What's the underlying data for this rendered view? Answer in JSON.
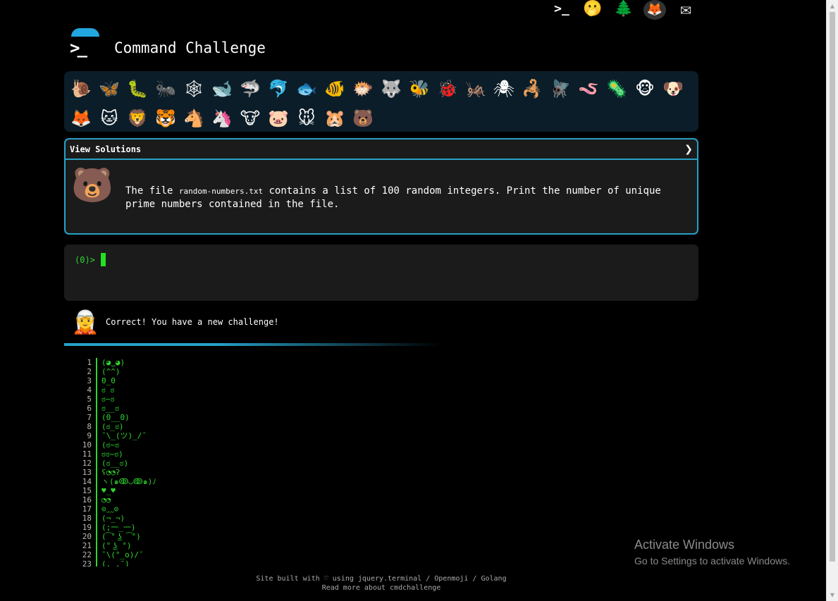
{
  "header": {
    "icons": [
      "prompt-icon",
      "hand-over-mouth-icon",
      "tree-icon",
      "gitlab-icon",
      "mail-icon"
    ]
  },
  "app": {
    "title": "Command Challenge"
  },
  "animals": [
    {
      "name": "snail-icon",
      "glyph": "🐌"
    },
    {
      "name": "butterfly-icon",
      "glyph": "🦋"
    },
    {
      "name": "caterpillar-icon",
      "glyph": "🐛"
    },
    {
      "name": "ant-icon",
      "glyph": "🐜"
    },
    {
      "name": "spiderweb-icon",
      "glyph": "🕸"
    },
    {
      "name": "whale-icon",
      "glyph": "🐋"
    },
    {
      "name": "shark-icon",
      "glyph": "🦈"
    },
    {
      "name": "dolphin-icon",
      "glyph": "🐬"
    },
    {
      "name": "fish-icon",
      "glyph": "🐟"
    },
    {
      "name": "tropical-fish-icon",
      "glyph": "🐠"
    },
    {
      "name": "blowfish-icon",
      "glyph": "🐡"
    },
    {
      "name": "wolf-icon",
      "glyph": "🐺"
    },
    {
      "name": "bee-icon",
      "glyph": "🐝"
    },
    {
      "name": "ladybug-icon",
      "glyph": "🐞"
    },
    {
      "name": "cricket-icon",
      "glyph": "🦗"
    },
    {
      "name": "spider-icon",
      "glyph": "🕷"
    },
    {
      "name": "scorpion-icon",
      "glyph": "🦂"
    },
    {
      "name": "fly-icon",
      "glyph": "🪰"
    },
    {
      "name": "worm-icon",
      "glyph": "🪱"
    },
    {
      "name": "microbe-icon",
      "glyph": "🦠"
    },
    {
      "name": "monkey-icon",
      "glyph": "🐵"
    },
    {
      "name": "dog-icon",
      "glyph": "🐶"
    },
    {
      "name": "fox-icon",
      "glyph": "🦊"
    },
    {
      "name": "cat-icon",
      "glyph": "🐱"
    },
    {
      "name": "lion-icon",
      "glyph": "🦁"
    },
    {
      "name": "tiger-icon",
      "glyph": "🐯"
    },
    {
      "name": "horse-icon",
      "glyph": "🐴"
    },
    {
      "name": "unicorn-icon",
      "glyph": "🦄"
    },
    {
      "name": "cow-icon",
      "glyph": "🐮"
    },
    {
      "name": "pig-icon",
      "glyph": "🐷"
    },
    {
      "name": "mouse-icon",
      "glyph": "🐭"
    },
    {
      "name": "hamster-icon",
      "glyph": "🐹"
    },
    {
      "name": "bear-icon",
      "glyph": "🐻"
    }
  ],
  "solutions": {
    "header_label": "View Solutions",
    "chevron": "❯",
    "avatar": "🐻",
    "challenge_prefix": "The file ",
    "challenge_file": "random-numbers.txt",
    "challenge_suffix": " contains a list of 100 random integers. Print the number of unique prime numbers contained in the file."
  },
  "terminal": {
    "prompt": "(0)>"
  },
  "feedback": {
    "avatar": "🧝",
    "message": "Correct! You have a new challenge!"
  },
  "emoticons": [
    {
      "n": "1",
      "t": "(◕‿◕)"
    },
    {
      "n": "2",
      "t": "(^^)"
    },
    {
      "n": "3",
      "t": "0_0"
    },
    {
      "n": "4",
      "t": "ಠ ಠ"
    },
    {
      "n": "5",
      "t": "ಠ~ಠ"
    },
    {
      "n": "6",
      "t": "ಠ__ಠ"
    },
    {
      "n": "7",
      "t": "(0__0)"
    },
    {
      "n": "8",
      "t": "(ಠ_ಠ)"
    },
    {
      "n": "9",
      "t": "¯\\_(ツ)_/¯"
    },
    {
      "n": "10",
      "t": "(ಠ~ಠ"
    },
    {
      "n": "11",
      "t": "ಠಠ~ಠ)"
    },
    {
      "n": "12",
      "t": "(ಠ__ಠ)"
    },
    {
      "n": "13",
      "t": "ʕ◔◔ʔ"
    },
    {
      "n": "14",
      "t": "ヽ(๑ↂ◡ↂ๑)ﾉ"
    },
    {
      "n": "15",
      "t": "♥_♥"
    },
    {
      "n": "16",
      "t": "◔◔"
    },
    {
      "n": "17",
      "t": "⊙﹏⊙"
    },
    {
      "n": "18",
      "t": "(¬_¬)"
    },
    {
      "n": "19",
      "t": "(;一_一)"
    },
    {
      "n": "20",
      "t": "(͡° ͜ʖ ͡°)"
    },
    {
      "n": "21",
      "t": "(° ͜ʖ °)"
    },
    {
      "n": "22",
      "t": "¯\\(°_o)/¯"
    },
    {
      "n": "23",
      "t": "(._.¯)"
    }
  ],
  "footer": {
    "line1": "Site built with ♡ using jquery.terminal / Openmoji / Golang",
    "line2": "Read more about cmdchallenge"
  },
  "os_watermark": {
    "title": "Activate Windows",
    "subtitle": "Go to Settings to activate Windows."
  },
  "colors": {
    "accent": "#27a1c9",
    "terminal_green": "#2fd62f",
    "panel_bg": "#1b1b1b",
    "strip_bg": "#0b1d28"
  }
}
